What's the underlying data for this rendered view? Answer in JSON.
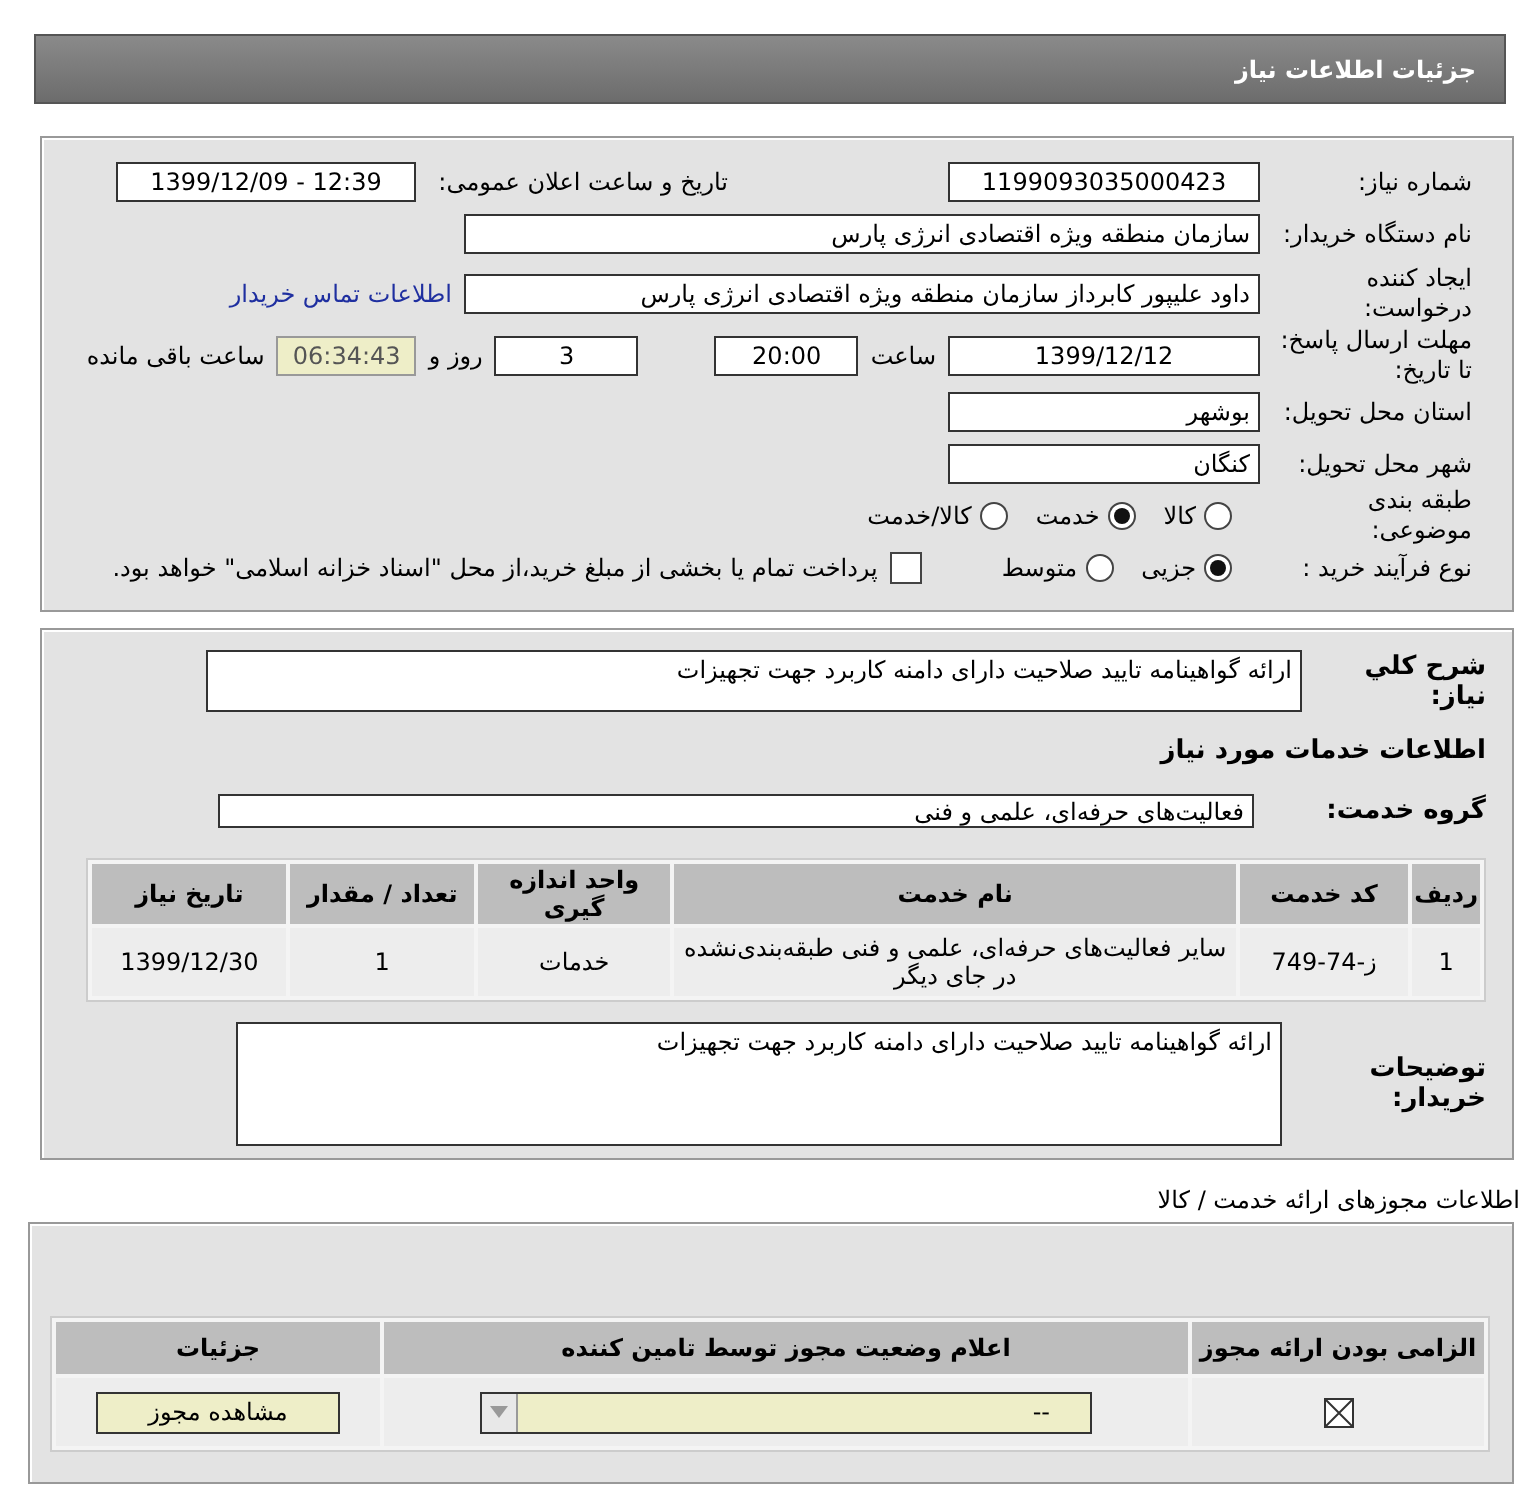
{
  "header": {
    "title": "جزئیات اطلاعات نیاز"
  },
  "details": {
    "need_number": {
      "label": "شماره نیاز:",
      "value": "1199093035000423"
    },
    "announce": {
      "label": "تاریخ و ساعت اعلان عمومی:",
      "value": "1399/12/09 - 12:39"
    },
    "buyer": {
      "label": "نام دستگاه خریدار:",
      "value": "سازمان منطقه ویژه اقتصادی انرژی پارس"
    },
    "creator": {
      "label": "ایجاد کننده درخواست:",
      "value": "داود علیپور کابرداز سازمان منطقه ویژه اقتصادی انرژی پارس"
    },
    "contact_link": "اطلاعات تماس خریدار",
    "deadline": {
      "label": "مهلت ارسال پاسخ: تا تاریخ:",
      "date": "1399/12/12",
      "time_label": "ساعت",
      "time": "20:00",
      "days": "3",
      "days_label": "روز و",
      "remaining": "06:34:43",
      "remaining_label": "ساعت باقی مانده"
    },
    "province": {
      "label": "استان محل تحویل:",
      "value": "بوشهر"
    },
    "city": {
      "label": "شهر محل تحویل:",
      "value": "کنگان"
    },
    "category": {
      "label": "طبقه بندی موضوعی:",
      "options": [
        {
          "label": "کالا",
          "selected": false
        },
        {
          "label": "خدمت",
          "selected": true
        },
        {
          "label": "کالا/خدمت",
          "selected": false
        }
      ]
    },
    "process": {
      "label": "نوع فرآیند خرید :",
      "options": [
        {
          "label": "جزیی",
          "selected": true
        },
        {
          "label": "متوسط",
          "selected": false
        }
      ],
      "payment": {
        "label": "پرداخت تمام یا بخشی از مبلغ خرید،از محل \"اسناد خزانه اسلامی\" خواهد بود.",
        "checked": false
      }
    }
  },
  "summary": {
    "label": "شرح کلي نياز:",
    "value": "ارائه گواهینامه تایید صلاحیت دارای دامنه کاربرد جهت تجهیزات"
  },
  "services_title": "اطلاعات خدمات مورد نیاز",
  "service_group": {
    "label": "گروه خدمت:",
    "value": "فعالیت‌های حرفه‌ای، علمی و فنی"
  },
  "services_table": {
    "columns": [
      "ردیف",
      "کد خدمت",
      "نام خدمت",
      "واحد اندازه گیری",
      "تعداد / مقدار",
      "تاریخ نیاز"
    ],
    "rows": [
      [
        "1",
        "ز-74-749",
        "سایر فعالیت‌های حرفه‌ای، علمی و فنی طبقه‌بندی‌نشده در جای دیگر",
        "خدمات",
        "1",
        "1399/12/30"
      ]
    ]
  },
  "buyer_notes": {
    "label": "توضیحات خریدار:",
    "value": "ارائه گواهینامه تایید صلاحیت دارای دامنه کاربرد جهت تجهیزات"
  },
  "permits": {
    "title": "اطلاعات مجوزهای ارائه خدمت / کالا",
    "columns": [
      "الزامی بودن ارائه مجوز",
      "اعلام وضعیت مجوز توسط تامین کننده",
      "جزئیات"
    ],
    "rows": [
      {
        "required": true,
        "status": "--",
        "button": "مشاهده مجوز"
      }
    ]
  }
}
